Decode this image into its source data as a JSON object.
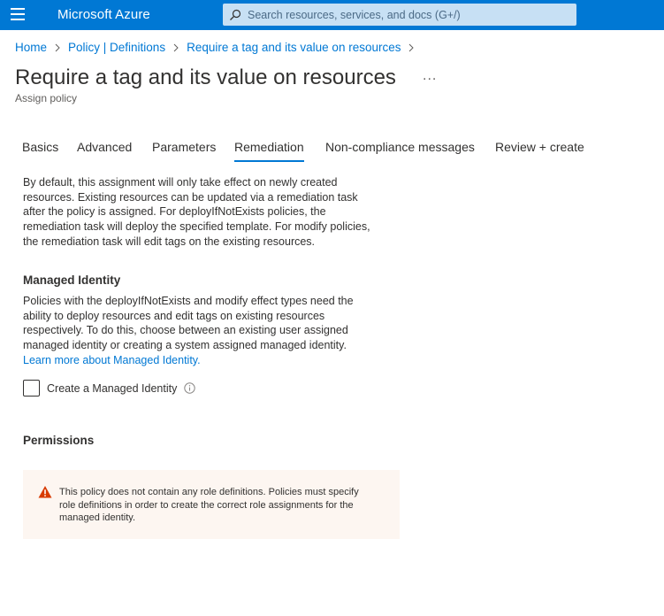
{
  "header": {
    "brand": "Microsoft Azure",
    "search_placeholder": "Search resources, services, and docs (G+/)"
  },
  "breadcrumb": [
    {
      "label": "Home"
    },
    {
      "label": "Policy | Definitions"
    },
    {
      "label": "Require a tag and its value on resources"
    }
  ],
  "page": {
    "title": "Require a tag and its value on resources",
    "more_label": "...",
    "subtitle": "Assign policy"
  },
  "tabs": [
    {
      "label": "Basics",
      "active": false
    },
    {
      "label": "Advanced",
      "active": false
    },
    {
      "label": "Parameters",
      "active": false
    },
    {
      "label": "Remediation",
      "active": true
    },
    {
      "label": "Non-compliance messages",
      "active": false
    },
    {
      "label": "Review + create",
      "active": false
    }
  ],
  "remediation": {
    "intro_lines": [
      "By default, this assignment will only take effect on newly created",
      "resources. Existing resources can be updated via a remediation task",
      "after the policy is assigned. For deployIfNotExists policies, the",
      "remediation task will deploy the specified template. For modify policies,",
      "the remediation task will edit tags on the existing resources."
    ],
    "managed_identity": {
      "title": "Managed Identity",
      "text_lines": [
        "Policies with the deployIfNotExists and modify effect types need the",
        "ability to deploy resources and edit tags on existing resources",
        "respectively. To do this, choose between an existing user assigned",
        "managed identity or creating a system assigned managed identity."
      ],
      "learn_more": "Learn more about Managed Identity.",
      "checkbox_label": "Create a Managed Identity",
      "checkbox_checked": false
    },
    "permissions": {
      "title": "Permissions",
      "warning_lines": [
        "This policy does not contain any role definitions. Policies must specify",
        "role definitions in order to create the correct role assignments for the",
        "managed identity."
      ]
    }
  },
  "colors": {
    "accent": "#0078d4",
    "search_bg": "#c7e0f4",
    "warning_bg": "#fdf6f1",
    "warning_icon": "#d83b01"
  }
}
